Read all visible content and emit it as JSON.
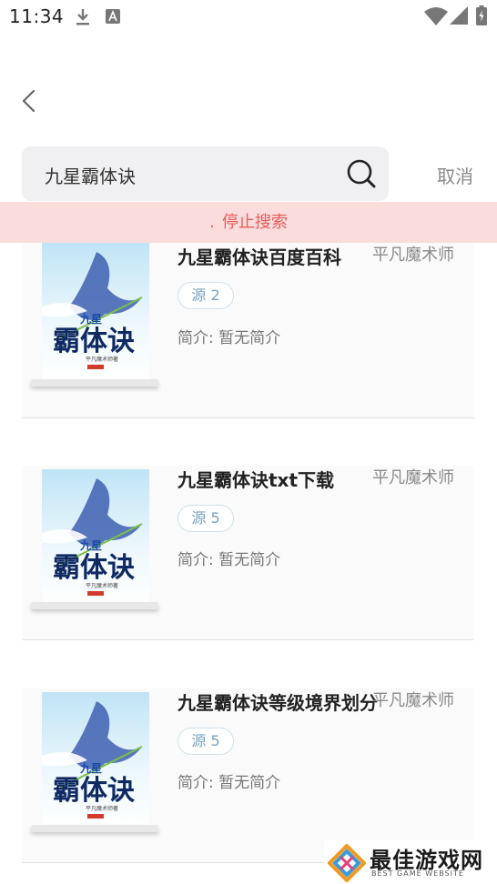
{
  "status_bar": {
    "time": "11:34"
  },
  "search": {
    "query": "九星霸体诀",
    "cancel_label": "取消"
  },
  "banner": {
    "dot": ".",
    "text": "停止搜索"
  },
  "results": [
    {
      "title": "九星霸体诀百度百科",
      "author": "平凡魔术师",
      "source": "源 2",
      "intro": "简介: 暂无简介"
    },
    {
      "title": "九星霸体诀txt下载",
      "author": "平凡魔术师",
      "source": "源 5",
      "intro": "简介: 暂无简介"
    },
    {
      "title": "九星霸体诀等级境界划分",
      "author": "平凡魔术师",
      "source": "源 5",
      "intro": "简介: 暂无简介"
    }
  ],
  "cover": {
    "small_title": "九星",
    "big_title": "霸体诀",
    "author_line": "平凡魔术师著"
  },
  "watermark": {
    "title": "最佳游戏网",
    "subtitle": "BEST GAME WEBSITE"
  },
  "colors": {
    "banner_bg": "#fbdcdc",
    "banner_text": "#ea5b5b",
    "badge_text": "#7aa3c2"
  }
}
